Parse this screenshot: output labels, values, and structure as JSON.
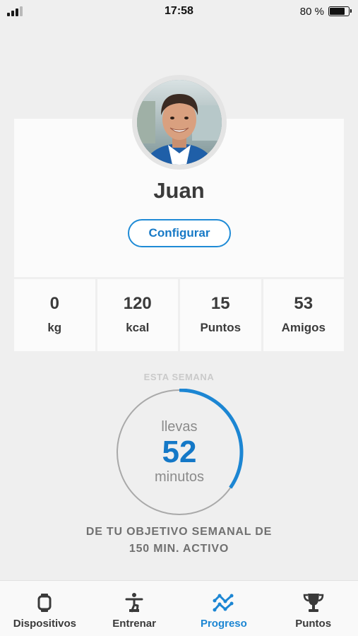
{
  "status_bar": {
    "time": "17:58",
    "battery_text": "80 %",
    "battery_level": 0.8,
    "signal_bars_on": 3,
    "signal_bars_total": 4
  },
  "profile": {
    "name": "Juan",
    "configure_label": "Configurar"
  },
  "stats": [
    {
      "value": "0",
      "label": "kg"
    },
    {
      "value": "120",
      "label": "kcal"
    },
    {
      "value": "15",
      "label": "Puntos"
    },
    {
      "value": "53",
      "label": "Amigos"
    }
  ],
  "weekly": {
    "section_label": "ESTA SEMANA",
    "prefix": "llevas",
    "minutes": 52,
    "unit": "minutos",
    "goal_minutes": 150,
    "goal_line1": "DE TU OBJETIVO SEMANAL DE",
    "goal_line2": "150 MIN. ACTIVO"
  },
  "tabs": [
    {
      "label": "Dispositivos",
      "icon": "watch-icon",
      "active": false
    },
    {
      "label": "Entrenar",
      "icon": "exercise-person-icon",
      "active": false
    },
    {
      "label": "Progreso",
      "icon": "progress-graph-icon",
      "active": true
    },
    {
      "label": "Puntos",
      "icon": "trophy-icon",
      "active": false
    }
  ],
  "colors": {
    "accent": "#1c86d3",
    "ring_track": "#a9a9a9",
    "background": "#efefef"
  }
}
